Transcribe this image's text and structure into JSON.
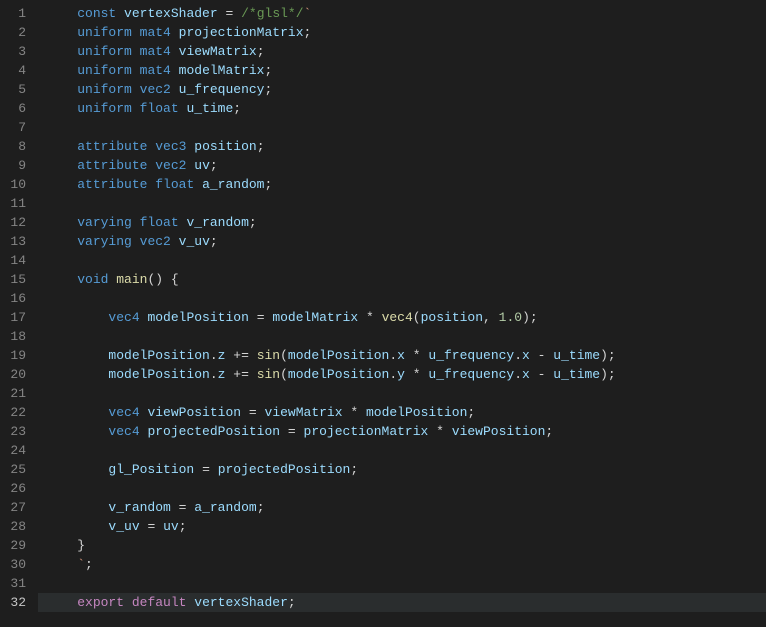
{
  "editor": {
    "activeLine": 32,
    "lines": [
      {
        "n": 1,
        "indent": 1,
        "tokens": [
          {
            "t": "kw",
            "v": "const"
          },
          {
            "t": "plain",
            "v": " "
          },
          {
            "t": "ident",
            "v": "vertexShader"
          },
          {
            "t": "plain",
            "v": " "
          },
          {
            "t": "op",
            "v": "="
          },
          {
            "t": "plain",
            "v": " "
          },
          {
            "t": "comment",
            "v": "/*glsl*/"
          },
          {
            "t": "str",
            "v": "`"
          }
        ]
      },
      {
        "n": 2,
        "indent": 1,
        "tokens": [
          {
            "t": "kw",
            "v": "uniform"
          },
          {
            "t": "plain",
            "v": " "
          },
          {
            "t": "type",
            "v": "mat4"
          },
          {
            "t": "plain",
            "v": " "
          },
          {
            "t": "ident",
            "v": "projectionMatrix"
          },
          {
            "t": "punct",
            "v": ";"
          }
        ]
      },
      {
        "n": 3,
        "indent": 1,
        "tokens": [
          {
            "t": "kw",
            "v": "uniform"
          },
          {
            "t": "plain",
            "v": " "
          },
          {
            "t": "type",
            "v": "mat4"
          },
          {
            "t": "plain",
            "v": " "
          },
          {
            "t": "ident",
            "v": "viewMatrix"
          },
          {
            "t": "punct",
            "v": ";"
          }
        ]
      },
      {
        "n": 4,
        "indent": 1,
        "tokens": [
          {
            "t": "kw",
            "v": "uniform"
          },
          {
            "t": "plain",
            "v": " "
          },
          {
            "t": "type",
            "v": "mat4"
          },
          {
            "t": "plain",
            "v": " "
          },
          {
            "t": "ident",
            "v": "modelMatrix"
          },
          {
            "t": "punct",
            "v": ";"
          }
        ]
      },
      {
        "n": 5,
        "indent": 1,
        "tokens": [
          {
            "t": "kw",
            "v": "uniform"
          },
          {
            "t": "plain",
            "v": " "
          },
          {
            "t": "type",
            "v": "vec2"
          },
          {
            "t": "plain",
            "v": " "
          },
          {
            "t": "ident",
            "v": "u_frequency"
          },
          {
            "t": "punct",
            "v": ";"
          }
        ]
      },
      {
        "n": 6,
        "indent": 1,
        "tokens": [
          {
            "t": "kw",
            "v": "uniform"
          },
          {
            "t": "plain",
            "v": " "
          },
          {
            "t": "type",
            "v": "float"
          },
          {
            "t": "plain",
            "v": " "
          },
          {
            "t": "ident",
            "v": "u_time"
          },
          {
            "t": "punct",
            "v": ";"
          }
        ]
      },
      {
        "n": 7,
        "indent": 0,
        "tokens": []
      },
      {
        "n": 8,
        "indent": 1,
        "tokens": [
          {
            "t": "kw",
            "v": "attribute"
          },
          {
            "t": "plain",
            "v": " "
          },
          {
            "t": "type",
            "v": "vec3"
          },
          {
            "t": "plain",
            "v": " "
          },
          {
            "t": "ident",
            "v": "position"
          },
          {
            "t": "punct",
            "v": ";"
          }
        ]
      },
      {
        "n": 9,
        "indent": 1,
        "tokens": [
          {
            "t": "kw",
            "v": "attribute"
          },
          {
            "t": "plain",
            "v": " "
          },
          {
            "t": "type",
            "v": "vec2"
          },
          {
            "t": "plain",
            "v": " "
          },
          {
            "t": "ident",
            "v": "uv"
          },
          {
            "t": "punct",
            "v": ";"
          }
        ]
      },
      {
        "n": 10,
        "indent": 1,
        "tokens": [
          {
            "t": "kw",
            "v": "attribute"
          },
          {
            "t": "plain",
            "v": " "
          },
          {
            "t": "type",
            "v": "float"
          },
          {
            "t": "plain",
            "v": " "
          },
          {
            "t": "ident",
            "v": "a_random"
          },
          {
            "t": "punct",
            "v": ";"
          }
        ]
      },
      {
        "n": 11,
        "indent": 0,
        "tokens": []
      },
      {
        "n": 12,
        "indent": 1,
        "tokens": [
          {
            "t": "kw",
            "v": "varying"
          },
          {
            "t": "plain",
            "v": " "
          },
          {
            "t": "type",
            "v": "float"
          },
          {
            "t": "plain",
            "v": " "
          },
          {
            "t": "ident",
            "v": "v_random"
          },
          {
            "t": "punct",
            "v": ";"
          }
        ]
      },
      {
        "n": 13,
        "indent": 1,
        "tokens": [
          {
            "t": "kw",
            "v": "varying"
          },
          {
            "t": "plain",
            "v": " "
          },
          {
            "t": "type",
            "v": "vec2"
          },
          {
            "t": "plain",
            "v": " "
          },
          {
            "t": "ident",
            "v": "v_uv"
          },
          {
            "t": "punct",
            "v": ";"
          }
        ]
      },
      {
        "n": 14,
        "indent": 0,
        "tokens": []
      },
      {
        "n": 15,
        "indent": 1,
        "tokens": [
          {
            "t": "type",
            "v": "void"
          },
          {
            "t": "plain",
            "v": " "
          },
          {
            "t": "func",
            "v": "main"
          },
          {
            "t": "punct",
            "v": "()"
          },
          {
            "t": "plain",
            "v": " "
          },
          {
            "t": "punct",
            "v": "{"
          }
        ]
      },
      {
        "n": 16,
        "indent": 0,
        "tokens": []
      },
      {
        "n": 17,
        "indent": 2,
        "tokens": [
          {
            "t": "type",
            "v": "vec4"
          },
          {
            "t": "plain",
            "v": " "
          },
          {
            "t": "ident",
            "v": "modelPosition"
          },
          {
            "t": "plain",
            "v": " "
          },
          {
            "t": "op",
            "v": "="
          },
          {
            "t": "plain",
            "v": " "
          },
          {
            "t": "ident",
            "v": "modelMatrix"
          },
          {
            "t": "plain",
            "v": " "
          },
          {
            "t": "op",
            "v": "*"
          },
          {
            "t": "plain",
            "v": " "
          },
          {
            "t": "func",
            "v": "vec4"
          },
          {
            "t": "punct",
            "v": "("
          },
          {
            "t": "ident",
            "v": "position"
          },
          {
            "t": "punct",
            "v": ","
          },
          {
            "t": "plain",
            "v": " "
          },
          {
            "t": "num",
            "v": "1.0"
          },
          {
            "t": "punct",
            "v": ")"
          },
          {
            "t": "punct",
            "v": ";"
          }
        ]
      },
      {
        "n": 18,
        "indent": 0,
        "tokens": []
      },
      {
        "n": 19,
        "indent": 2,
        "tokens": [
          {
            "t": "ident",
            "v": "modelPosition"
          },
          {
            "t": "punct",
            "v": "."
          },
          {
            "t": "ident",
            "v": "z"
          },
          {
            "t": "plain",
            "v": " "
          },
          {
            "t": "op",
            "v": "+="
          },
          {
            "t": "plain",
            "v": " "
          },
          {
            "t": "func",
            "v": "sin"
          },
          {
            "t": "punct",
            "v": "("
          },
          {
            "t": "ident",
            "v": "modelPosition"
          },
          {
            "t": "punct",
            "v": "."
          },
          {
            "t": "ident",
            "v": "x"
          },
          {
            "t": "plain",
            "v": " "
          },
          {
            "t": "op",
            "v": "*"
          },
          {
            "t": "plain",
            "v": " "
          },
          {
            "t": "ident",
            "v": "u_frequency"
          },
          {
            "t": "punct",
            "v": "."
          },
          {
            "t": "ident",
            "v": "x"
          },
          {
            "t": "plain",
            "v": " "
          },
          {
            "t": "op",
            "v": "-"
          },
          {
            "t": "plain",
            "v": " "
          },
          {
            "t": "ident",
            "v": "u_time"
          },
          {
            "t": "punct",
            "v": ")"
          },
          {
            "t": "punct",
            "v": ";"
          }
        ]
      },
      {
        "n": 20,
        "indent": 2,
        "tokens": [
          {
            "t": "ident",
            "v": "modelPosition"
          },
          {
            "t": "punct",
            "v": "."
          },
          {
            "t": "ident",
            "v": "z"
          },
          {
            "t": "plain",
            "v": " "
          },
          {
            "t": "op",
            "v": "+="
          },
          {
            "t": "plain",
            "v": " "
          },
          {
            "t": "func",
            "v": "sin"
          },
          {
            "t": "punct",
            "v": "("
          },
          {
            "t": "ident",
            "v": "modelPosition"
          },
          {
            "t": "punct",
            "v": "."
          },
          {
            "t": "ident",
            "v": "y"
          },
          {
            "t": "plain",
            "v": " "
          },
          {
            "t": "op",
            "v": "*"
          },
          {
            "t": "plain",
            "v": " "
          },
          {
            "t": "ident",
            "v": "u_frequency"
          },
          {
            "t": "punct",
            "v": "."
          },
          {
            "t": "ident",
            "v": "x"
          },
          {
            "t": "plain",
            "v": " "
          },
          {
            "t": "op",
            "v": "-"
          },
          {
            "t": "plain",
            "v": " "
          },
          {
            "t": "ident",
            "v": "u_time"
          },
          {
            "t": "punct",
            "v": ")"
          },
          {
            "t": "punct",
            "v": ";"
          }
        ]
      },
      {
        "n": 21,
        "indent": 0,
        "tokens": []
      },
      {
        "n": 22,
        "indent": 2,
        "tokens": [
          {
            "t": "type",
            "v": "vec4"
          },
          {
            "t": "plain",
            "v": " "
          },
          {
            "t": "ident",
            "v": "viewPosition"
          },
          {
            "t": "plain",
            "v": " "
          },
          {
            "t": "op",
            "v": "="
          },
          {
            "t": "plain",
            "v": " "
          },
          {
            "t": "ident",
            "v": "viewMatrix"
          },
          {
            "t": "plain",
            "v": " "
          },
          {
            "t": "op",
            "v": "*"
          },
          {
            "t": "plain",
            "v": " "
          },
          {
            "t": "ident",
            "v": "modelPosition"
          },
          {
            "t": "punct",
            "v": ";"
          }
        ]
      },
      {
        "n": 23,
        "indent": 2,
        "tokens": [
          {
            "t": "type",
            "v": "vec4"
          },
          {
            "t": "plain",
            "v": " "
          },
          {
            "t": "ident",
            "v": "projectedPosition"
          },
          {
            "t": "plain",
            "v": " "
          },
          {
            "t": "op",
            "v": "="
          },
          {
            "t": "plain",
            "v": " "
          },
          {
            "t": "ident",
            "v": "projectionMatrix"
          },
          {
            "t": "plain",
            "v": " "
          },
          {
            "t": "op",
            "v": "*"
          },
          {
            "t": "plain",
            "v": " "
          },
          {
            "t": "ident",
            "v": "viewPosition"
          },
          {
            "t": "punct",
            "v": ";"
          }
        ]
      },
      {
        "n": 24,
        "indent": 0,
        "tokens": []
      },
      {
        "n": 25,
        "indent": 2,
        "tokens": [
          {
            "t": "builtin",
            "v": "gl_Position"
          },
          {
            "t": "plain",
            "v": " "
          },
          {
            "t": "op",
            "v": "="
          },
          {
            "t": "plain",
            "v": " "
          },
          {
            "t": "ident",
            "v": "projectedPosition"
          },
          {
            "t": "punct",
            "v": ";"
          }
        ]
      },
      {
        "n": 26,
        "indent": 0,
        "tokens": []
      },
      {
        "n": 27,
        "indent": 2,
        "tokens": [
          {
            "t": "ident",
            "v": "v_random"
          },
          {
            "t": "plain",
            "v": " "
          },
          {
            "t": "op",
            "v": "="
          },
          {
            "t": "plain",
            "v": " "
          },
          {
            "t": "ident",
            "v": "a_random"
          },
          {
            "t": "punct",
            "v": ";"
          }
        ]
      },
      {
        "n": 28,
        "indent": 2,
        "tokens": [
          {
            "t": "ident",
            "v": "v_uv"
          },
          {
            "t": "plain",
            "v": " "
          },
          {
            "t": "op",
            "v": "="
          },
          {
            "t": "plain",
            "v": " "
          },
          {
            "t": "ident",
            "v": "uv"
          },
          {
            "t": "punct",
            "v": ";"
          }
        ]
      },
      {
        "n": 29,
        "indent": 1,
        "tokens": [
          {
            "t": "punct",
            "v": "}"
          }
        ]
      },
      {
        "n": 30,
        "indent": 1,
        "tokens": [
          {
            "t": "str",
            "v": "`"
          },
          {
            "t": "punct",
            "v": ";"
          }
        ]
      },
      {
        "n": 31,
        "indent": 0,
        "tokens": []
      },
      {
        "n": 32,
        "indent": 1,
        "tokens": [
          {
            "t": "kw2",
            "v": "export"
          },
          {
            "t": "plain",
            "v": " "
          },
          {
            "t": "kw2",
            "v": "default"
          },
          {
            "t": "plain",
            "v": " "
          },
          {
            "t": "ident",
            "v": "vertexShader"
          },
          {
            "t": "punct",
            "v": ";"
          }
        ]
      }
    ]
  }
}
